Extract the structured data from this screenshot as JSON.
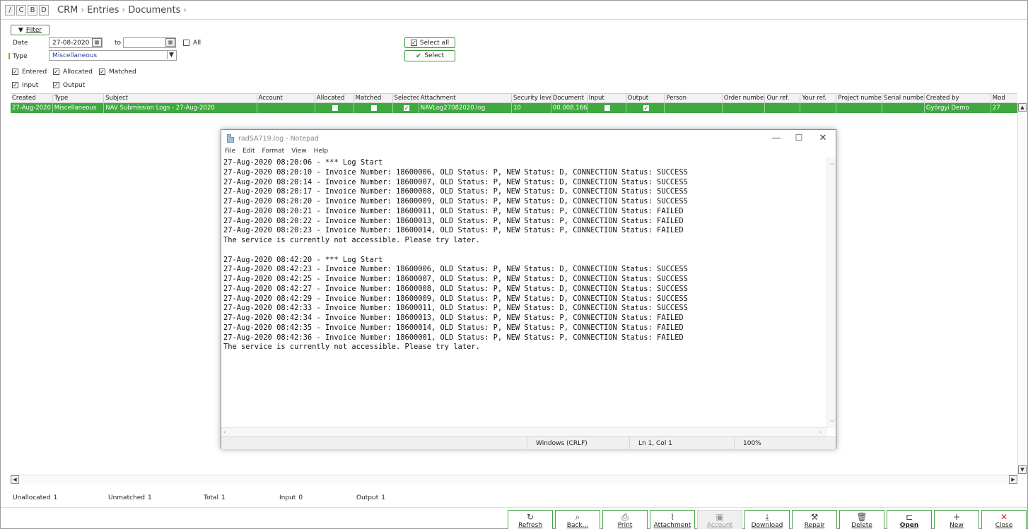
{
  "topbar": {
    "mode_buttons": [
      "/",
      "C",
      "B",
      "D"
    ],
    "breadcrumb": [
      "CRM",
      "Entries",
      "Documents"
    ]
  },
  "filter": {
    "filter_label": "Filter",
    "date_label": "Date",
    "date_from": "27-08-2020",
    "to_label": "to",
    "date_to": "",
    "all_label": "All",
    "type_label": "Type",
    "type_value": "Miscellaneous",
    "select_all_label": "Select all",
    "select_label": "Select",
    "entered_label": "Entered",
    "allocated_label": "Allocated",
    "matched_label": "Matched",
    "input_label": "Input",
    "output_label": "Output"
  },
  "grid": {
    "columns": [
      "Created",
      "Type",
      "Subject",
      "Account",
      "Allocated",
      "Matched",
      "Selected",
      "Attachment",
      "Security level",
      "Document",
      "Input",
      "Output",
      "Person",
      "Order number",
      "Our ref.",
      "Your ref.",
      "Project number",
      "Serial number",
      "Created by",
      "Mod"
    ],
    "row": {
      "created": "27-Aug-2020",
      "type": "Miscellaneous",
      "subject": "NAV Submission Logs - 27-Aug-2020",
      "account": "",
      "allocated": false,
      "matched": false,
      "selected": true,
      "attachment": "NAVLog27082020.log",
      "security_level": "10",
      "document": "00.008.166",
      "input": false,
      "output": true,
      "person": "",
      "order_number": "",
      "our_ref": "",
      "your_ref": "",
      "project_number": "",
      "serial_number": "",
      "created_by": "Györgyi Demo",
      "mod": "27"
    }
  },
  "notepad": {
    "title": "radSA719.log - Notepad",
    "menu": [
      "File",
      "Edit",
      "Format",
      "View",
      "Help"
    ],
    "lines": [
      "27-Aug-2020 08:20:06 - *** Log Start",
      "27-Aug-2020 08:20:10 - Invoice Number: 18600006, OLD Status: P, NEW Status: D, CONNECTION Status: SUCCESS",
      "27-Aug-2020 08:20:14 - Invoice Number: 18600007, OLD Status: P, NEW Status: D, CONNECTION Status: SUCCESS",
      "27-Aug-2020 08:20:17 - Invoice Number: 18600008, OLD Status: P, NEW Status: D, CONNECTION Status: SUCCESS",
      "27-Aug-2020 08:20:20 - Invoice Number: 18600009, OLD Status: P, NEW Status: D, CONNECTION Status: SUCCESS",
      "27-Aug-2020 08:20:21 - Invoice Number: 18600011, OLD Status: P, NEW Status: P, CONNECTION Status: FAILED",
      "27-Aug-2020 08:20:22 - Invoice Number: 18600013, OLD Status: P, NEW Status: P, CONNECTION Status: FAILED",
      "27-Aug-2020 08:20:23 - Invoice Number: 18600014, OLD Status: P, NEW Status: P, CONNECTION Status: FAILED",
      "The service is currently not accessible. Please try later.",
      "",
      "27-Aug-2020 08:42:20 - *** Log Start",
      "27-Aug-2020 08:42:23 - Invoice Number: 18600006, OLD Status: P, NEW Status: D, CONNECTION Status: SUCCESS",
      "27-Aug-2020 08:42:25 - Invoice Number: 18600007, OLD Status: P, NEW Status: D, CONNECTION Status: SUCCESS",
      "27-Aug-2020 08:42:27 - Invoice Number: 18600008, OLD Status: P, NEW Status: D, CONNECTION Status: SUCCESS",
      "27-Aug-2020 08:42:29 - Invoice Number: 18600009, OLD Status: P, NEW Status: D, CONNECTION Status: SUCCESS",
      "27-Aug-2020 08:42:33 - Invoice Number: 18600011, OLD Status: P, NEW Status: D, CONNECTION Status: SUCCESS",
      "27-Aug-2020 08:42:34 - Invoice Number: 18600013, OLD Status: P, NEW Status: P, CONNECTION Status: FAILED",
      "27-Aug-2020 08:42:35 - Invoice Number: 18600014, OLD Status: P, NEW Status: P, CONNECTION Status: FAILED",
      "27-Aug-2020 08:42:36 - Invoice Number: 18600001, OLD Status: P, NEW Status: P, CONNECTION Status: FAILED",
      "The service is currently not accessible. Please try later."
    ],
    "status_encoding": "Windows (CRLF)",
    "status_position": "Ln 1, Col 1",
    "status_zoom": "100%"
  },
  "counters": {
    "unallocated_label": "Unallocated",
    "unallocated": "1",
    "unmatched_label": "Unmatched",
    "unmatched": "1",
    "total_label": "Total",
    "total": "1",
    "input_label": "Input",
    "input": "0",
    "output_label": "Output",
    "output": "1"
  },
  "toolbar": {
    "refresh": "Refresh",
    "back": "Back...",
    "print": "Print",
    "attachment": "Attachment",
    "account": "Account",
    "download": "Download",
    "repair": "Repair",
    "delete": "Delete",
    "open": "Open",
    "new": "New",
    "close": "Close"
  },
  "colors": {
    "accent_green": "#3ea93e",
    "close_red": "#d62020"
  }
}
